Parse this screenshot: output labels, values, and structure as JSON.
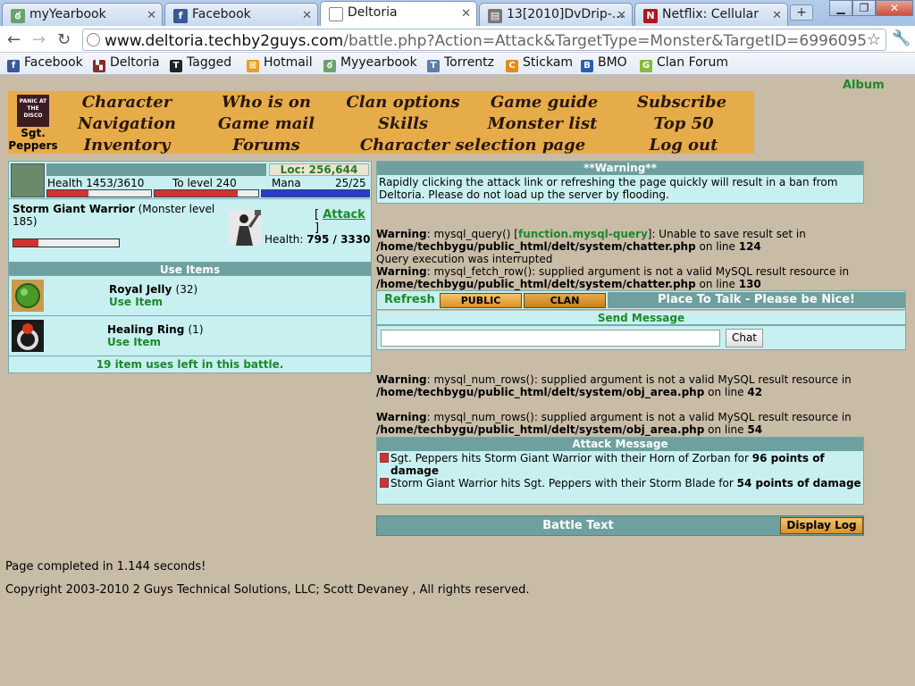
{
  "browser": {
    "tabs": [
      {
        "title": "myYearbook",
        "favicon": "myyearbook-icon"
      },
      {
        "title": "Facebook",
        "favicon": "facebook-icon"
      },
      {
        "title": "Deltoria",
        "favicon": "page-icon",
        "active": true
      },
      {
        "title": "13[2010]DvDrip-...",
        "favicon": "document-icon"
      },
      {
        "title": "Netflix: Cellular",
        "favicon": "netflix-icon"
      }
    ],
    "url_domain": "www.deltoria.techby2guys.com",
    "url_path": "/battle.php?Action=Attack&TargetType=Monster&TargetID=6996095",
    "bookmarks": [
      "Facebook",
      "Deltoria",
      "Tagged",
      "Hotmail",
      "Myyearbook",
      "Torrentz",
      "Stickam",
      "BMO",
      "Clan Forum"
    ]
  },
  "player": {
    "name": "Sgt. Peppers",
    "avatar_text": "PANIC AT THE DISCO",
    "health": "Health 1453/3610",
    "to_level": "To level 240",
    "mana_label": "Mana",
    "mana": "25/25",
    "location": "Loc: 256,644",
    "health_fraction": 0.4,
    "tolevel_fraction": 0.8,
    "mana_fraction": 1.0
  },
  "menu": {
    "col1": [
      "Character",
      "Navigation",
      "Inventory"
    ],
    "col2": [
      "Who is on",
      "Game mail",
      "Forums"
    ],
    "col3": [
      "Clan options",
      "Skills",
      "Character selection page"
    ],
    "col4": [
      "Game guide",
      "Monster list"
    ],
    "col5": [
      "Subscribe",
      "Top 50",
      "Log out"
    ],
    "album": "Album"
  },
  "monster": {
    "name": "Storm Giant Warrior",
    "level_text": "(Monster level 185)",
    "attack_label": "Attack",
    "health_label": "Health:",
    "health_value": "795 / 3330",
    "health_fraction": 0.24
  },
  "items": {
    "header": "Use Items",
    "list": [
      {
        "name": "Royal Jelly",
        "count": "(32)",
        "action": "Use Item"
      },
      {
        "name": "Healing Ring",
        "count": "(1)",
        "action": "Use Item"
      }
    ],
    "uses_left": "19 item uses left in this battle."
  },
  "warning": {
    "title": "**Warning**",
    "text": "Rapidly clicking the attack link or refreshing the page quickly will result in a ban from Deltoria. Please do not load up the server by flooding."
  },
  "php_errors": {
    "e1_prefix": "Warning",
    "e1_a": ": mysql_query() [",
    "e1_fn": "function.mysql-query",
    "e1_b": "]: Unable to save result set in",
    "e1_path": "/home/techbygu/public_html/delt/system/chatter.php",
    "e1_on": " on line ",
    "e1_line": "124",
    "e1_interrupted": "Query execution was interrupted",
    "e2_prefix": "Warning",
    "e2_msg": ": mysql_fetch_row(): supplied argument is not a valid MySQL result resource in",
    "e2_path": "/home/techbygu/public_html/delt/system/chatter.php",
    "e2_on": " on line ",
    "e2_line": "130",
    "e3_prefix": "Warning",
    "e3_msg": ": mysql_num_rows(): supplied argument is not a valid MySQL result resource in",
    "e3_path": "/home/techbygu/public_html/delt/system/obj_area.php",
    "e3_on": " on line ",
    "e3_line": "42",
    "e4_prefix": "Warning",
    "e4_msg": ": mysql_num_rows(): supplied argument is not a valid MySQL result resource in",
    "e4_path": "/home/techbygu/public_html/delt/system/obj_area.php",
    "e4_on": " on line ",
    "e4_line": "54"
  },
  "chat": {
    "refresh": "Refresh",
    "public": "PUBLIC",
    "clan": "CLAN",
    "title": "Place To Talk - Please be Nice!",
    "send_message": "Send Message",
    "input_value": "",
    "chat_button": "Chat"
  },
  "attack_message": {
    "header": "Attack Message",
    "line1_a": "Sgt. Peppers hits Storm Giant Warrior with their Horn of Zorban for ",
    "line1_b": "96 points of damage",
    "line2_a": "Storm Giant Warrior hits Sgt. Peppers with their Storm Blade for ",
    "line2_b": "54 points of damage"
  },
  "battle": {
    "text": "Battle Text",
    "display_log": "Display Log"
  },
  "footer": {
    "completed": "Page completed in 1.144 seconds!",
    "copyright": "Copyright 2003-2010 2 Guys Technical Solutions, LLC; Scott Devaney , All rights reserved."
  }
}
